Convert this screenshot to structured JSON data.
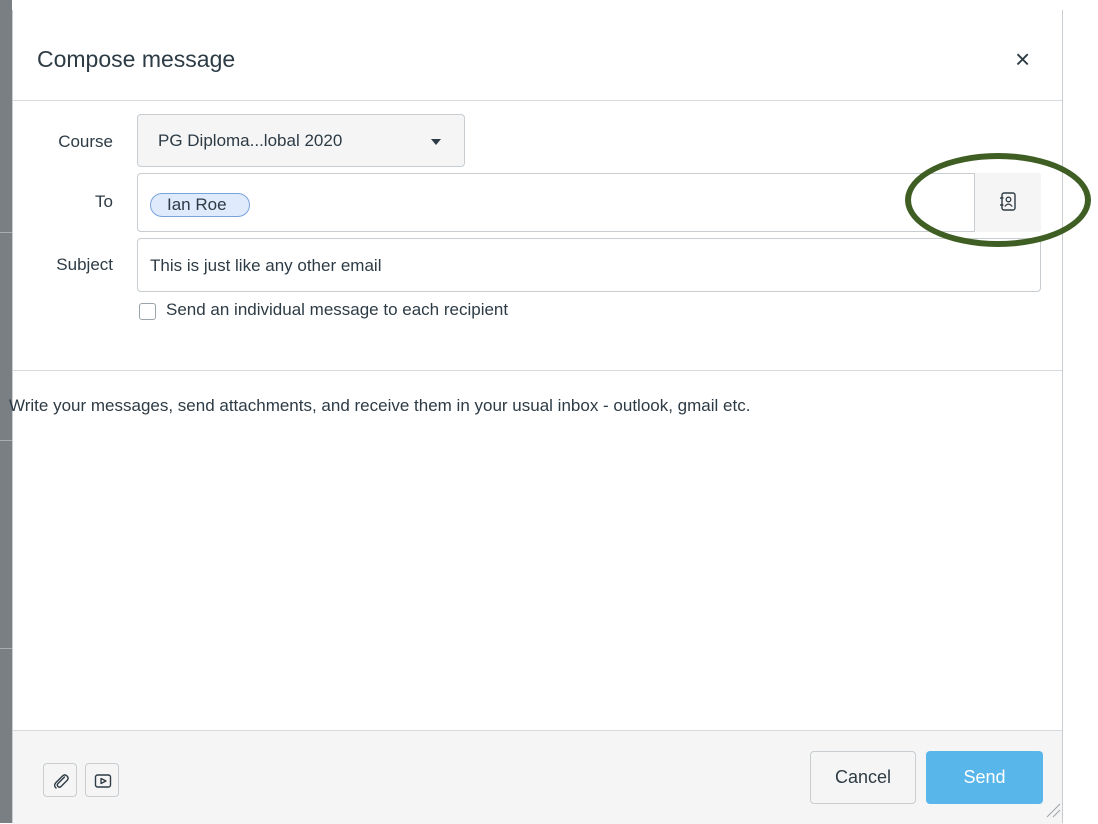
{
  "dialog": {
    "title": "Compose message",
    "close_glyph": "×"
  },
  "form": {
    "course_label": "Course",
    "course_value": "PG Diploma...lobal 2020",
    "to_label": "To",
    "recipients": [
      "Ian Roe"
    ],
    "subject_label": "Subject",
    "subject_value": "This is just like any other email",
    "individual_message_label": "Send an individual message to each recipient",
    "individual_message_checked": false
  },
  "message": {
    "body": "Write your messages, send attachments, and receive them in your usual inbox - outlook, gmail etc."
  },
  "footer": {
    "cancel_label": "Cancel",
    "send_label": "Send"
  },
  "icons": {
    "address_book": "address-book-icon",
    "attachment": "paperclip-icon",
    "media": "media-icon"
  },
  "colors": {
    "send_button": "#59b6ea",
    "highlight_ring": "#3f5e23",
    "token_bg": "#dfeafc",
    "token_border": "#7aa3d9"
  }
}
